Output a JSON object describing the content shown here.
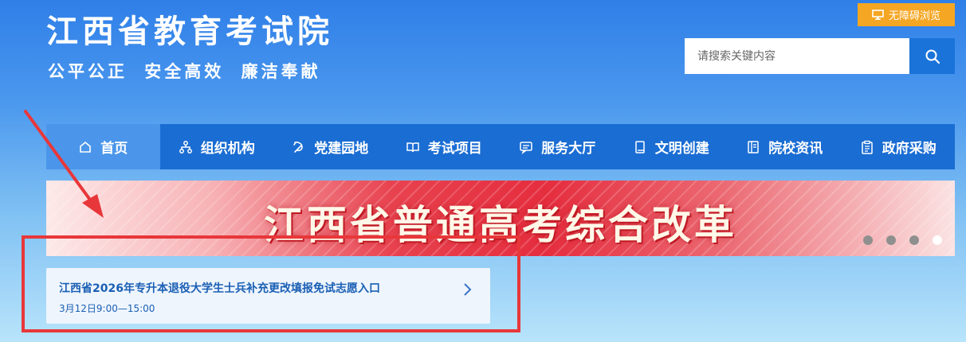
{
  "header": {
    "title": "江西省教育考试院",
    "slogan": "公平公正  安全高效  廉洁奉献",
    "accessibility_label": "无障碍浏览",
    "accessibility_icon": "monitor-icon"
  },
  "search": {
    "placeholder": "请搜索关键内容",
    "icon": "search-icon"
  },
  "nav": {
    "items": [
      {
        "label": "首页",
        "icon": "home-icon"
      },
      {
        "label": "组织机构",
        "icon": "org-chart-icon"
      },
      {
        "label": "党建园地",
        "icon": "party-icon"
      },
      {
        "label": "考试项目",
        "icon": "book-icon"
      },
      {
        "label": "服务大厅",
        "icon": "service-icon"
      },
      {
        "label": "文明创建",
        "icon": "booklet-icon"
      },
      {
        "label": "院校资讯",
        "icon": "news-icon"
      },
      {
        "label": "政府采购",
        "icon": "clipboard-icon"
      }
    ],
    "active_index": 0
  },
  "banner": {
    "text": "江西省普通高考综合改革",
    "slide_count": 4,
    "active_slide": 4
  },
  "notice": {
    "title": "江西省2026年专升本退役大学生士兵补充更改填报免试志愿入口",
    "time": "3月12日9:00—15:00"
  },
  "colors": {
    "nav_bg": "#1a6dd3",
    "nav_active": "#4b96ea",
    "accent_orange": "#f5a623",
    "annotation_red": "#e8373a"
  }
}
